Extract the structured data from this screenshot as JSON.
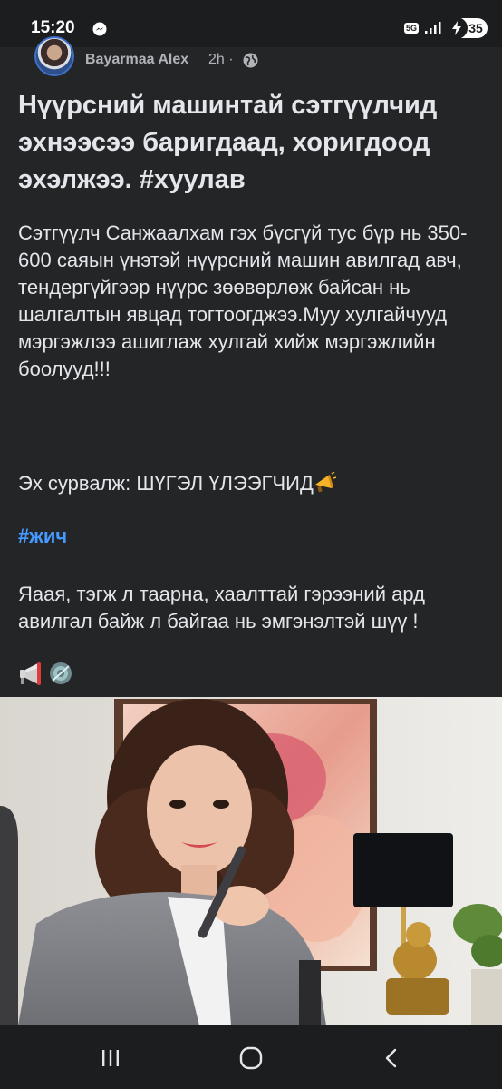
{
  "status_bar": {
    "time": "15:20",
    "network": "5G",
    "battery": "35"
  },
  "post": {
    "author": "Bayarmaa Alex",
    "time": "2h",
    "title": "Нүүрсний машинтай сэтгүүлчид эхнээсээ баригдаад, хоригдоод эхэлжээ. #хуулав",
    "body_1": "Сэтгүүлч Санжаалхам гэх бүсгүй тус бүр нь 350-600 саяын үнэтэй нүүрсний машин авилгад авч, тендергүйгээр нүүрс зөөвөрлөж байсан нь шалгалтын явцад тогтоогджээ.Муу хулгайчууд мэргэжлээ ашиглаж хулгай хийж мэргэжлийн боолууд!!!",
    "source": "Эх сурвалж: ШҮГЭЛ ҮЛЭЭГЧИД",
    "hashtag": "#жич",
    "body_2": "Яаая, тэгж л таарна, хаалттай гэрээний ард авилгал байж л байгаа нь эмгэнэлтэй шүү !"
  },
  "icons": {
    "messenger": "messenger-icon",
    "signal": "signal-icon",
    "globe": "globe-icon",
    "megaphone": "megaphone-icon",
    "loudspeaker": "loudspeaker-icon",
    "seal": "seal-icon",
    "recent_apps": "recent-apps-icon",
    "home": "home-icon",
    "back": "back-icon"
  },
  "colors": {
    "background": "#242526",
    "text": "#e4e6eb",
    "secondary_text": "#b0b3b8",
    "hashtag": "#4599ff"
  }
}
